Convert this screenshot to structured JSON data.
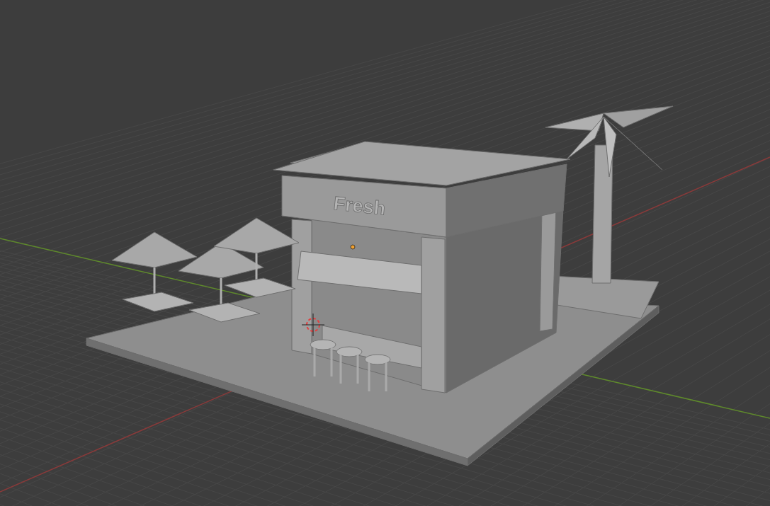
{
  "viewport": {
    "sign_text": "Fresh"
  }
}
